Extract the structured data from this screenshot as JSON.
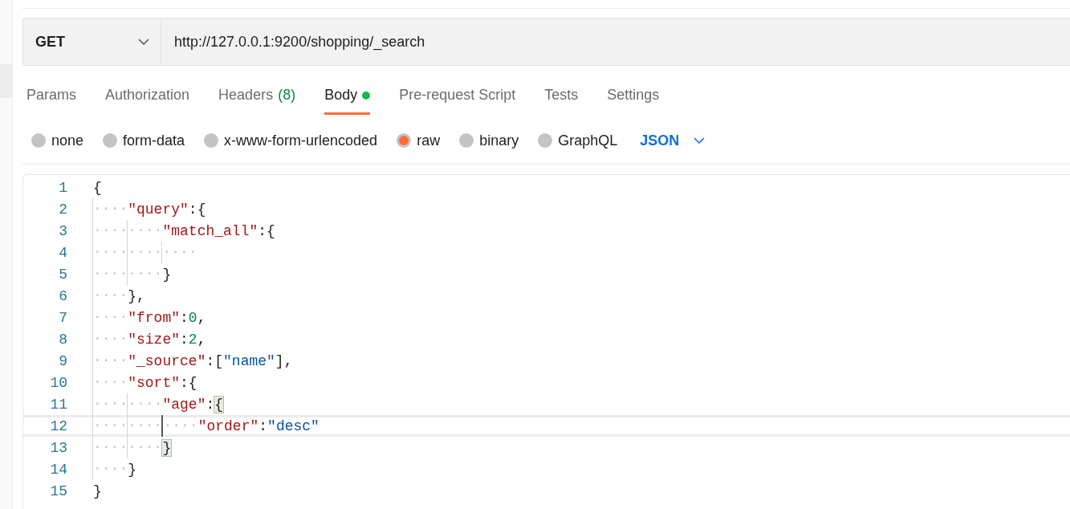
{
  "request": {
    "method": "GET",
    "url": "http://127.0.0.1:9200/shopping/_search"
  },
  "tabs": [
    {
      "label": "Params",
      "selected": false
    },
    {
      "label": "Authorization",
      "selected": false
    },
    {
      "label": "Headers",
      "count": "(8)",
      "selected": false
    },
    {
      "label": "Body",
      "selected": true,
      "has_content": true
    },
    {
      "label": "Pre-request Script",
      "selected": false
    },
    {
      "label": "Tests",
      "selected": false
    },
    {
      "label": "Settings",
      "selected": false
    }
  ],
  "body_types": [
    {
      "label": "none",
      "selected": false
    },
    {
      "label": "form-data",
      "selected": false
    },
    {
      "label": "x-www-form-urlencoded",
      "selected": false
    },
    {
      "label": "raw",
      "selected": true
    },
    {
      "label": "binary",
      "selected": false
    },
    {
      "label": "GraphQL",
      "selected": false
    }
  ],
  "format": "JSON",
  "editor": {
    "lines": [
      {
        "number": "1",
        "current": false,
        "tokens": [
          {
            "kind": "punct",
            "text": "{"
          }
        ]
      },
      {
        "number": "2",
        "current": false,
        "tokens": [
          {
            "kind": "indent",
            "text": "····"
          },
          {
            "kind": "key",
            "text": "\"query\""
          },
          {
            "kind": "punct",
            "text": ":{"
          }
        ]
      },
      {
        "number": "3",
        "current": false,
        "tokens": [
          {
            "kind": "indent",
            "text": "········"
          },
          {
            "kind": "key",
            "text": "\"match_all\""
          },
          {
            "kind": "punct",
            "text": ":{"
          }
        ]
      },
      {
        "number": "4",
        "current": false,
        "tokens": [
          {
            "kind": "indent",
            "text": "············"
          }
        ]
      },
      {
        "number": "5",
        "current": false,
        "tokens": [
          {
            "kind": "indent",
            "text": "········"
          },
          {
            "kind": "punct",
            "text": "}"
          }
        ]
      },
      {
        "number": "6",
        "current": false,
        "tokens": [
          {
            "kind": "indent",
            "text": "····"
          },
          {
            "kind": "punct",
            "text": "},"
          }
        ]
      },
      {
        "number": "7",
        "current": false,
        "tokens": [
          {
            "kind": "indent",
            "text": "····"
          },
          {
            "kind": "key",
            "text": "\"from\""
          },
          {
            "kind": "punct",
            "text": ":"
          },
          {
            "kind": "number",
            "text": "0"
          },
          {
            "kind": "punct",
            "text": ","
          }
        ]
      },
      {
        "number": "8",
        "current": false,
        "tokens": [
          {
            "kind": "indent",
            "text": "····"
          },
          {
            "kind": "key",
            "text": "\"size\""
          },
          {
            "kind": "punct",
            "text": ":"
          },
          {
            "kind": "number",
            "text": "2"
          },
          {
            "kind": "punct",
            "text": ","
          }
        ]
      },
      {
        "number": "9",
        "current": false,
        "tokens": [
          {
            "kind": "indent",
            "text": "····"
          },
          {
            "kind": "key",
            "text": "\"_source\""
          },
          {
            "kind": "punct",
            "text": ":["
          },
          {
            "kind": "string",
            "text": "\"name\""
          },
          {
            "kind": "punct",
            "text": "],"
          }
        ]
      },
      {
        "number": "10",
        "current": false,
        "tokens": [
          {
            "kind": "indent",
            "text": "····"
          },
          {
            "kind": "key",
            "text": "\"sort\""
          },
          {
            "kind": "punct",
            "text": ":{"
          }
        ]
      },
      {
        "number": "11",
        "current": false,
        "tokens": [
          {
            "kind": "indent",
            "text": "········"
          },
          {
            "kind": "key",
            "text": "\"age\""
          },
          {
            "kind": "punct",
            "text": ":"
          },
          {
            "kind": "bracket",
            "text": "{",
            "matched": true
          }
        ]
      },
      {
        "number": "12",
        "current": true,
        "tokens": [
          {
            "kind": "indent",
            "text": "············"
          },
          {
            "kind": "key",
            "text": "\"order\""
          },
          {
            "kind": "punct",
            "text": ":"
          },
          {
            "kind": "string",
            "text": "\"desc\""
          }
        ]
      },
      {
        "number": "13",
        "current": false,
        "tokens": [
          {
            "kind": "indent",
            "text": "········"
          },
          {
            "kind": "bracket",
            "text": "}",
            "matched": true
          }
        ]
      },
      {
        "number": "14",
        "current": false,
        "tokens": [
          {
            "kind": "indent",
            "text": "····"
          },
          {
            "kind": "punct",
            "text": "}"
          }
        ]
      },
      {
        "number": "15",
        "current": false,
        "tokens": [
          {
            "kind": "punct",
            "text": "}"
          }
        ]
      }
    ]
  }
}
